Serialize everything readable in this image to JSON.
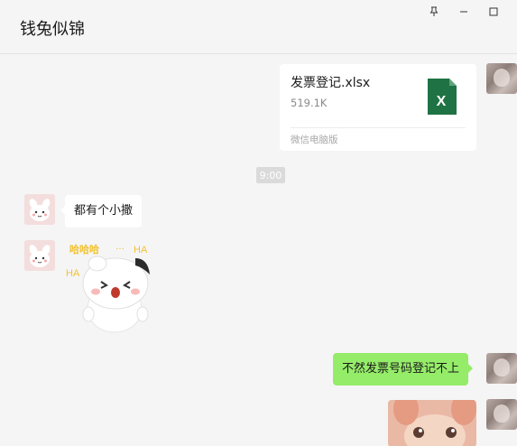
{
  "window": {
    "title": "钱兔似锦",
    "controls": {
      "pin_icon": "pin-icon",
      "minimize_icon": "minimize-icon",
      "maximize_icon": "maximize-icon"
    }
  },
  "messages": {
    "file": {
      "name": "发票登记.xlsx",
      "size": "519.1K",
      "source": "微信电脑版",
      "icon_letter": "X",
      "icon_color": "#1f7244"
    },
    "time": "9:00",
    "incoming_text": "都有个小撒",
    "sticker_text": {
      "line1": "哈哈哈",
      "dots": "…",
      "ha1": "HA",
      "ha2": "HA"
    },
    "outgoing_text": "不然发票号码登记不上"
  },
  "colors": {
    "outgoing_bubble": "#95ec69",
    "incoming_bubble": "#ffffff",
    "background": "#f5f5f5"
  }
}
